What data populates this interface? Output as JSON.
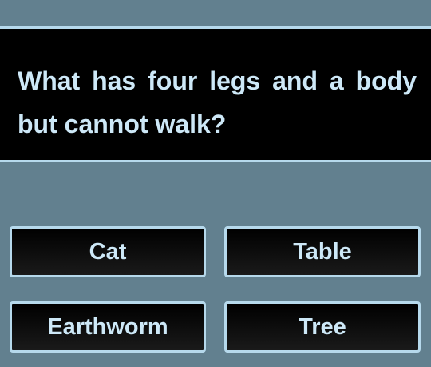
{
  "question": {
    "text": "What has four legs and a body but cannot walk?"
  },
  "answers": [
    {
      "label": "Cat"
    },
    {
      "label": "Table"
    },
    {
      "label": "Earthworm"
    },
    {
      "label": "Tree"
    }
  ],
  "colors": {
    "background": "#62808f",
    "panel": "#000000",
    "border": "#b6d9ec",
    "text": "#cde8f7"
  }
}
